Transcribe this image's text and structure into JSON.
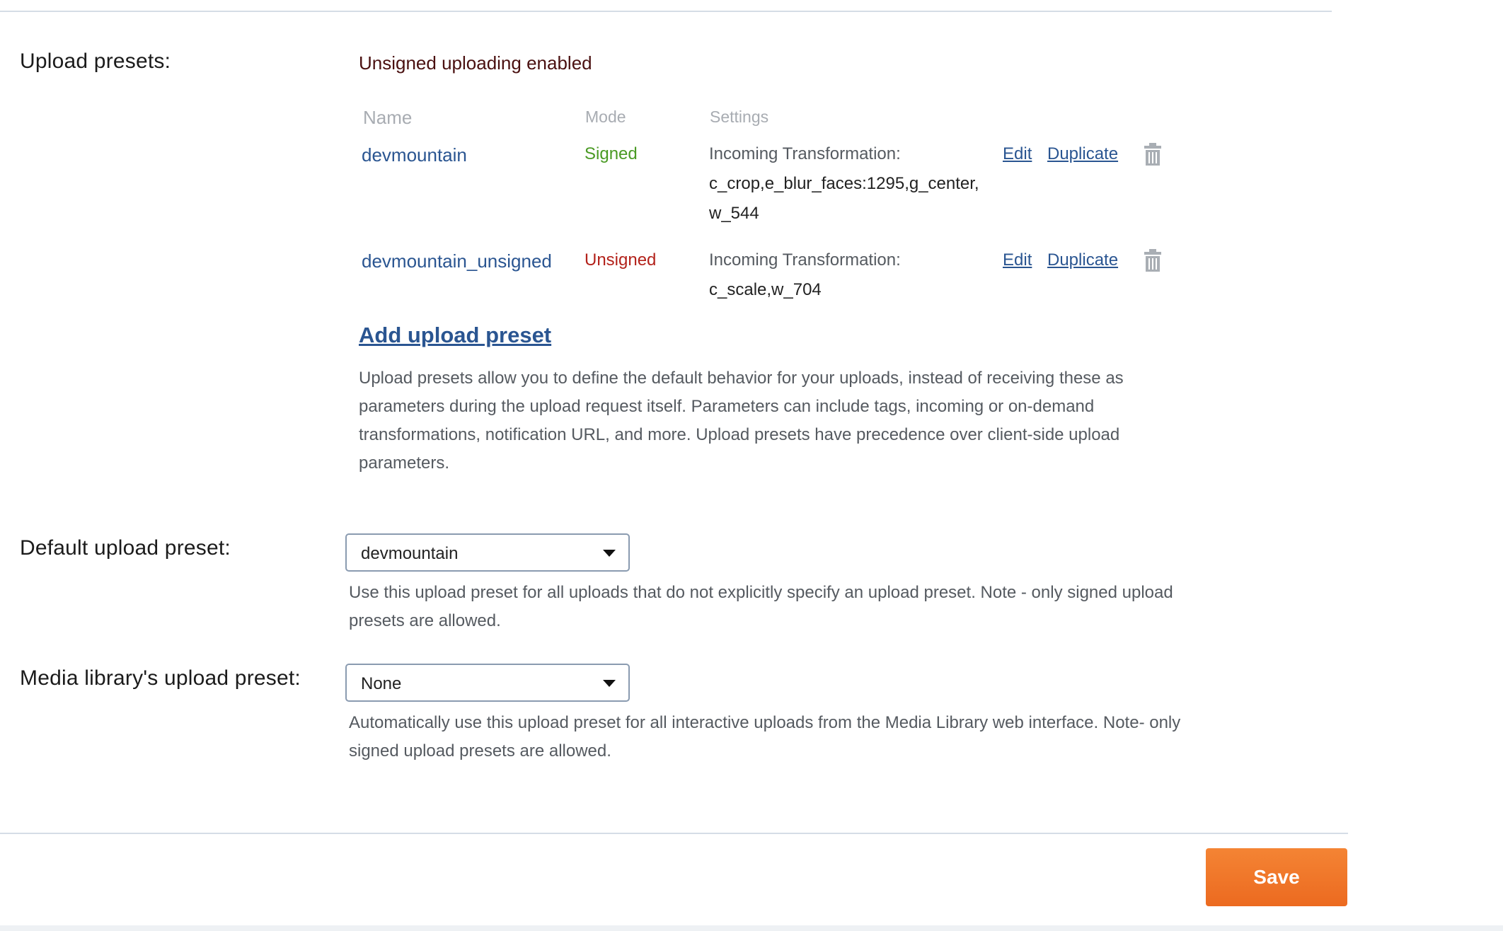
{
  "upload_presets": {
    "label": "Upload presets:",
    "status": "Unsigned uploading enabled",
    "columns": {
      "name": "Name",
      "mode": "Mode",
      "settings": "Settings"
    },
    "rows": [
      {
        "name": "devmountain",
        "mode": "Signed",
        "settings_label": "Incoming Transformation:",
        "settings_value": "c_crop,e_blur_faces:1295,g_center,w_544",
        "edit": "Edit",
        "duplicate": "Duplicate"
      },
      {
        "name": "devmountain_unsigned",
        "mode": "Unsigned",
        "settings_label": "Incoming Transformation:",
        "settings_value": "c_scale,w_704",
        "edit": "Edit",
        "duplicate": "Duplicate"
      }
    ],
    "add_link": "Add upload preset",
    "help": "Upload presets allow you to define the default behavior for your uploads, instead of receiving these as parameters during the upload request itself. Parameters can include tags, incoming or on-demand transformations, notification URL, and more. Upload presets have precedence over client-side upload parameters."
  },
  "default_preset": {
    "label": "Default upload preset:",
    "selected": "devmountain",
    "help": "Use this upload preset for all uploads that do not explicitly specify an upload preset. Note - only signed upload presets are allowed."
  },
  "media_library_preset": {
    "label": "Media library's upload preset:",
    "selected": "None",
    "help": "Automatically use this upload preset for all interactive uploads from the Media Library web interface. Note- only signed upload presets are allowed."
  },
  "footer": {
    "save_label": "Save"
  },
  "icons": {
    "delete": "trash-icon",
    "dropdown": "chevron-down-icon"
  },
  "colors": {
    "link": "#2a5591",
    "signed": "#4a9a24",
    "unsigned": "#b3221b",
    "save_button": "#ef7428"
  }
}
